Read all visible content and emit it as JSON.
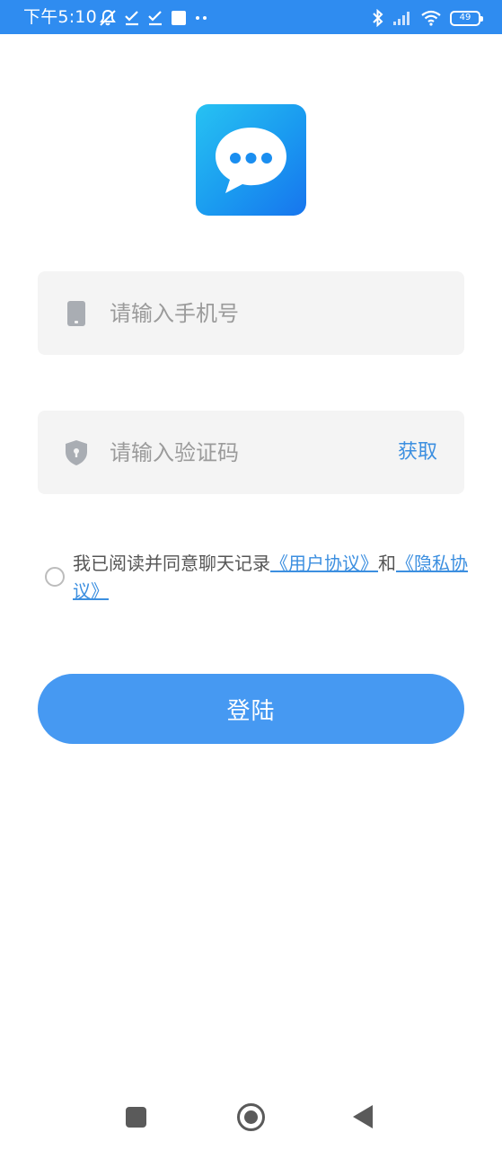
{
  "status_bar": {
    "time": "下午5:10",
    "left_icons": [
      "mute-icon",
      "check-icon",
      "check-icon",
      "square-icon",
      "dots-icon"
    ],
    "right_icons": [
      "bluetooth-icon",
      "signal-icon",
      "wifi-icon"
    ],
    "battery_level": "49"
  },
  "app_logo": {
    "icon": "chat-bubble-icon",
    "colors": [
      "#27c2f2",
      "#1775ee"
    ]
  },
  "phone_field": {
    "placeholder": "请输入手机号",
    "value": "",
    "icon": "phone-icon"
  },
  "code_field": {
    "placeholder": "请输入验证码",
    "value": "",
    "icon": "shield-icon",
    "get_code_label": "获取"
  },
  "agreement": {
    "checked": false,
    "text_prefix": "我已阅读并同意聊天记录",
    "user_agreement_link": "《用户协议》",
    "conjunction": "和",
    "privacy_link": "《隐私协议》"
  },
  "login_button": {
    "label": "登陆"
  },
  "colors": {
    "accent": "#4699f2",
    "status_bar": "#2f8cf0",
    "link": "#3c8fe0",
    "field_bg": "#f4f4f4"
  },
  "nav_bar": {
    "icons": [
      "recent-apps-icon",
      "home-icon",
      "back-icon"
    ]
  }
}
